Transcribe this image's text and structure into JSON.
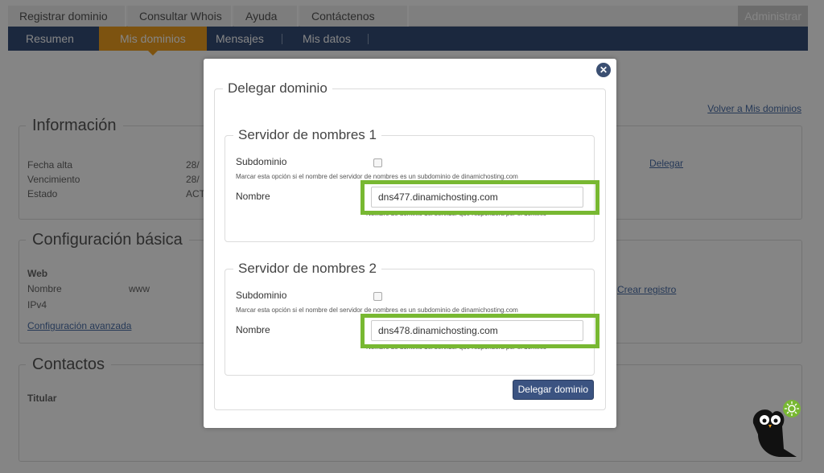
{
  "top_nav": {
    "tabs": [
      "Registrar dominio",
      "Consultar Whois",
      "Ayuda",
      "Contáctenos"
    ],
    "admin": "Administrar"
  },
  "sub_nav": {
    "items": [
      "Resumen",
      "Mis dominios",
      "Mensajes",
      "Mis datos"
    ],
    "active": "Mis dominios"
  },
  "background": {
    "back_link": "Volver a Mis dominios",
    "info": {
      "legend": "Información",
      "rows": [
        {
          "label": "Fecha alta",
          "value": "28/"
        },
        {
          "label": "Vencimiento",
          "value": "28/"
        },
        {
          "label": "Estado",
          "value": "ACT"
        }
      ],
      "action_link": "Delegar"
    },
    "config": {
      "legend": "Configuración básica",
      "section": "Web",
      "rows": [
        {
          "label": "Nombre",
          "value": "www"
        },
        {
          "label": "IPv4",
          "value": ""
        }
      ],
      "advanced_link": "Configuración avanzada",
      "create_link": "Crear registro"
    },
    "contacts": {
      "legend": "Contactos",
      "holder_label": "Titular"
    }
  },
  "modal": {
    "title": "Delegar dominio",
    "close_icon": "close-icon",
    "servers": [
      {
        "legend": "Servidor de nombres 1",
        "subdomain_label": "Subdominio",
        "subdomain_hint": "Marcar esta opción si el nombre del servidor de nombres es un subdominio de dinamichosting.com",
        "subdomain_checked": false,
        "name_label": "Nombre",
        "name_value": "dns477.dinamichosting.com",
        "name_hint": "Nombre de dominio del servidor que responderá por el dominio"
      },
      {
        "legend": "Servidor de nombres 2",
        "subdomain_label": "Subdominio",
        "subdomain_hint": "Marcar esta opción si el nombre del servidor de nombres es un subdominio de dinamichosting.com",
        "subdomain_checked": false,
        "name_label": "Nombre",
        "name_value": "dns478.dinamichosting.com",
        "name_hint": "Nombre de dominio del servidor que responderá por el dominio"
      }
    ],
    "submit_label": "Delegar dominio",
    "highlight_color": "#78b832"
  },
  "colors": {
    "nav_blue": "#354d77",
    "active_orange": "#f0a020",
    "button_blue": "#3b5381"
  },
  "mascot_icon": "owl-mascot-icon"
}
